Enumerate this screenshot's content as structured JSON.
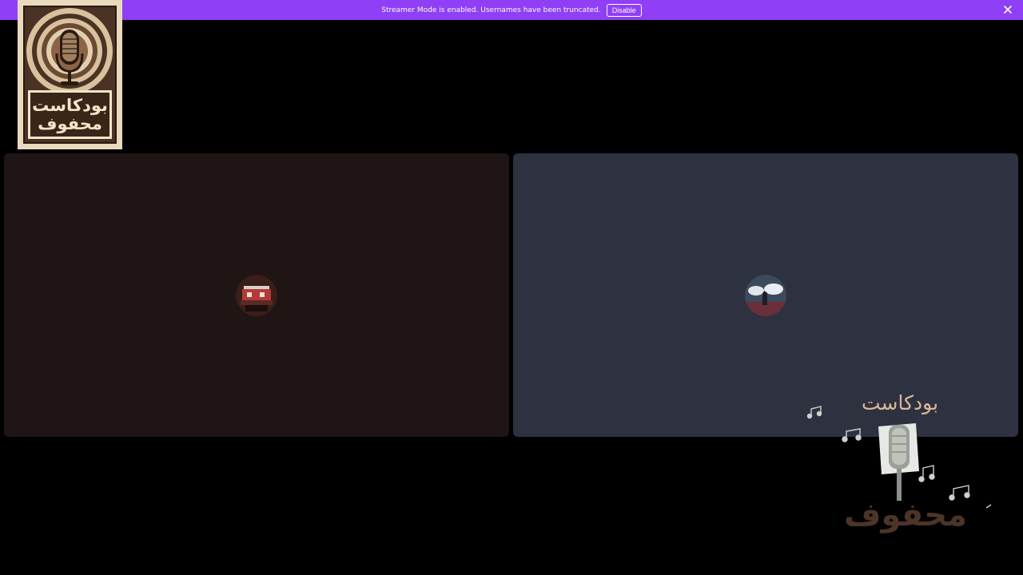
{
  "banner": {
    "message": "Streamer Mode is enabled. Usernames have been truncated.",
    "disable_label": "Disable",
    "background": "#8f3ff5"
  },
  "logo": {
    "line1": "بودكاست",
    "line2": "محفوف"
  },
  "overlay": {
    "top_text": "بودكاست",
    "bottom_text": "محفوف"
  },
  "tiles": [
    {
      "name": "participant-tile-1",
      "background": "#1f1514"
    },
    {
      "name": "participant-tile-2",
      "background": "#2e3140"
    }
  ]
}
